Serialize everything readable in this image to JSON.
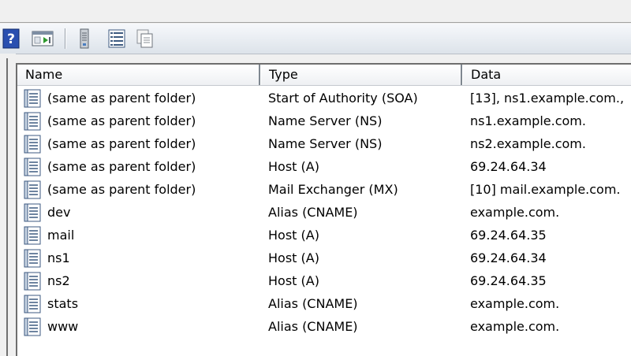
{
  "toolbar": {
    "buttons": [
      {
        "icon": "help-icon"
      },
      {
        "icon": "console-icon"
      },
      {
        "icon": "server-icon"
      },
      {
        "icon": "list-view-icon"
      },
      {
        "icon": "export-list-icon"
      }
    ]
  },
  "table": {
    "columns": [
      {
        "label": "Name"
      },
      {
        "label": "Type"
      },
      {
        "label": "Data"
      }
    ],
    "rows": [
      {
        "name": "(same as parent folder)",
        "type": "Start of Authority (SOA)",
        "data": "[13], ns1.example.com.,"
      },
      {
        "name": "(same as parent folder)",
        "type": "Name Server (NS)",
        "data": "ns1.example.com."
      },
      {
        "name": "(same as parent folder)",
        "type": "Name Server (NS)",
        "data": "ns2.example.com."
      },
      {
        "name": "(same as parent folder)",
        "type": "Host (A)",
        "data": "69.24.64.34"
      },
      {
        "name": "(same as parent folder)",
        "type": "Mail Exchanger (MX)",
        "data": "[10]  mail.example.com."
      },
      {
        "name": "dev",
        "type": "Alias (CNAME)",
        "data": "example.com."
      },
      {
        "name": "mail",
        "type": "Host (A)",
        "data": "69.24.64.35"
      },
      {
        "name": "ns1",
        "type": "Host (A)",
        "data": "69.24.64.34"
      },
      {
        "name": "ns2",
        "type": "Host (A)",
        "data": "69.24.64.35"
      },
      {
        "name": "stats",
        "type": "Alias (CNAME)",
        "data": "example.com."
      },
      {
        "name": "www",
        "type": "Alias (CNAME)",
        "data": "example.com."
      }
    ]
  }
}
